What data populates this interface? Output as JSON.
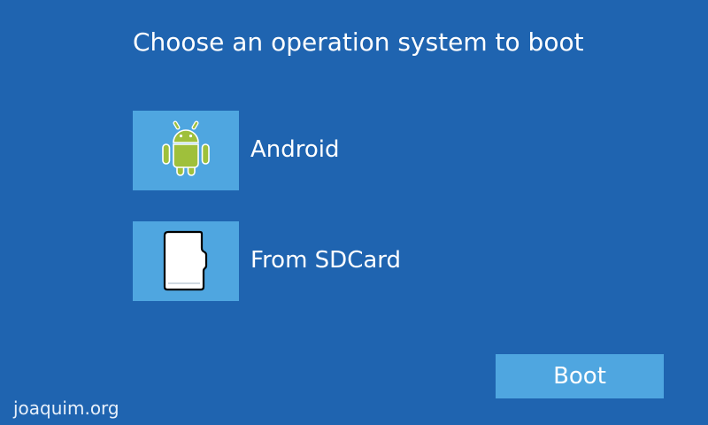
{
  "header": {
    "title": "Choose an operation system to boot"
  },
  "options": [
    {
      "label": "Android",
      "icon": "android-icon",
      "selected": false
    },
    {
      "label": "From SDCard",
      "icon": "sdcard-icon",
      "selected": false
    }
  ],
  "actions": {
    "boot_label": "Boot"
  },
  "footer": {
    "watermark": "joaquim.org"
  },
  "colors": {
    "background": "#1f64b0",
    "tile": "#4fa6e0",
    "android_green": "#9fc03b",
    "text": "#ffffff"
  }
}
